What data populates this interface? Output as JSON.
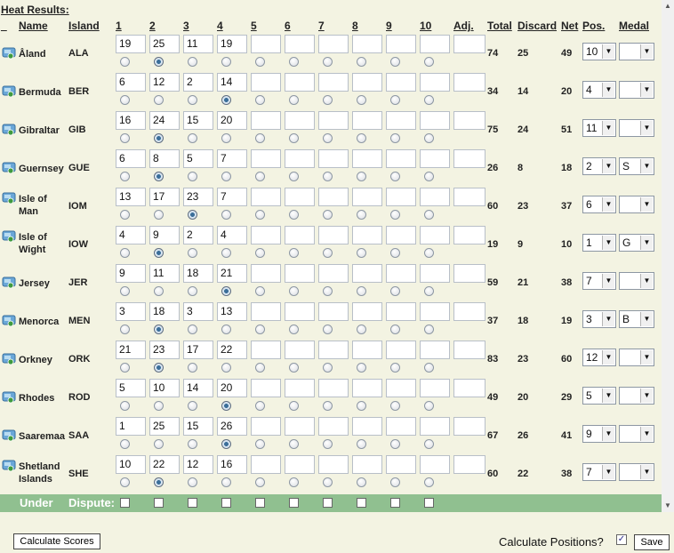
{
  "title": "Heat Results:",
  "headers": [
    "_",
    "Name",
    "Island",
    "1",
    "2",
    "3",
    "4",
    "5",
    "6",
    "7",
    "8",
    "9",
    "10",
    "Adj.",
    "Total",
    "Discard",
    "Net",
    "Pos.",
    "Medal"
  ],
  "rows": [
    {
      "name": "Åland",
      "code": "ALA",
      "scores": [
        "19",
        "25",
        "11",
        "19"
      ],
      "radio_selected": 2,
      "total": "74",
      "discard": "25",
      "net": "49",
      "pos": "10",
      "medal": ""
    },
    {
      "name": "Bermuda",
      "code": "BER",
      "scores": [
        "6",
        "12",
        "2",
        "14"
      ],
      "radio_selected": 4,
      "total": "34",
      "discard": "14",
      "net": "20",
      "pos": "4",
      "medal": ""
    },
    {
      "name": "Gibraltar",
      "code": "GIB",
      "scores": [
        "16",
        "24",
        "15",
        "20"
      ],
      "radio_selected": 2,
      "total": "75",
      "discard": "24",
      "net": "51",
      "pos": "11",
      "medal": ""
    },
    {
      "name": "Guernsey",
      "code": "GUE",
      "scores": [
        "6",
        "8",
        "5",
        "7"
      ],
      "radio_selected": 2,
      "total": "26",
      "discard": "8",
      "net": "18",
      "pos": "2",
      "medal": "S"
    },
    {
      "name": "Isle of Man",
      "code": "IOM",
      "scores": [
        "13",
        "17",
        "23",
        "7"
      ],
      "radio_selected": 3,
      "total": "60",
      "discard": "23",
      "net": "37",
      "pos": "6",
      "medal": ""
    },
    {
      "name": "Isle of Wight",
      "code": "IOW",
      "scores": [
        "4",
        "9",
        "2",
        "4"
      ],
      "radio_selected": 2,
      "total": "19",
      "discard": "9",
      "net": "10",
      "pos": "1",
      "medal": "G"
    },
    {
      "name": "Jersey",
      "code": "JER",
      "scores": [
        "9",
        "11",
        "18",
        "21"
      ],
      "radio_selected": 4,
      "total": "59",
      "discard": "21",
      "net": "38",
      "pos": "7",
      "medal": ""
    },
    {
      "name": "Menorca",
      "code": "MEN",
      "scores": [
        "3",
        "18",
        "3",
        "13"
      ],
      "radio_selected": 2,
      "total": "37",
      "discard": "18",
      "net": "19",
      "pos": "3",
      "medal": "B"
    },
    {
      "name": "Orkney",
      "code": "ORK",
      "scores": [
        "21",
        "23",
        "17",
        "22"
      ],
      "radio_selected": 2,
      "total": "83",
      "discard": "23",
      "net": "60",
      "pos": "12",
      "medal": ""
    },
    {
      "name": "Rhodes",
      "code": "ROD",
      "scores": [
        "5",
        "10",
        "14",
        "20"
      ],
      "radio_selected": 4,
      "total": "49",
      "discard": "20",
      "net": "29",
      "pos": "5",
      "medal": ""
    },
    {
      "name": "Saaremaa",
      "code": "SAA",
      "scores": [
        "1",
        "25",
        "15",
        "26"
      ],
      "radio_selected": 4,
      "total": "67",
      "discard": "26",
      "net": "41",
      "pos": "9",
      "medal": ""
    },
    {
      "name": "Shetland Islands",
      "code": "SHE",
      "scores": [
        "10",
        "22",
        "12",
        "16"
      ],
      "radio_selected": 2,
      "total": "60",
      "discard": "22",
      "net": "38",
      "pos": "7",
      "medal": ""
    }
  ],
  "dispute": {
    "label1": "Under",
    "label2": "Dispute:"
  },
  "footer": {
    "calculate_scores": "Calculate Scores",
    "calculate_positions": "Calculate Positions?",
    "calculate_positions_checked": "✓",
    "save": "Save"
  },
  "icons": {
    "flag": "flag-icon",
    "dropdown": "dropdown-arrow-icon",
    "scroll_up": "scroll-up-icon",
    "scroll_down": "scroll-down-icon"
  },
  "colors": {
    "background": "#f3f3e2",
    "dispute_bar": "#90c090",
    "radio_selected": "#3b6e99"
  }
}
